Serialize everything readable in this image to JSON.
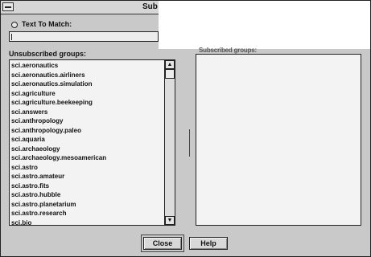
{
  "window": {
    "title": "Sub"
  },
  "filter": {
    "radio_label": "Text To Match:",
    "input_value": ""
  },
  "unsubscribed": {
    "label": "Unsubscribed groups:",
    "items": [
      "sci.aeronautics",
      "sci.aeronautics.airliners",
      "sci.aeronautics.simulation",
      "sci.agriculture",
      "sci.agriculture.beekeeping",
      "sci.answers",
      "sci.anthropology",
      "sci.anthropology.paleo",
      "sci.aquaria",
      "sci.archaeology",
      "sci.archaeology.mesoamerican",
      "sci.astro",
      "sci.astro.amateur",
      "sci.astro.fits",
      "sci.astro.hubble",
      "sci.astro.planetarium",
      "sci.astro.research",
      "sci.bio"
    ],
    "scroll_up_glyph": "▲",
    "scroll_down_glyph": "▼"
  },
  "subscribed": {
    "label": "Subscribed groups:"
  },
  "buttons": {
    "close_label": "Close",
    "help_label": "Help"
  }
}
